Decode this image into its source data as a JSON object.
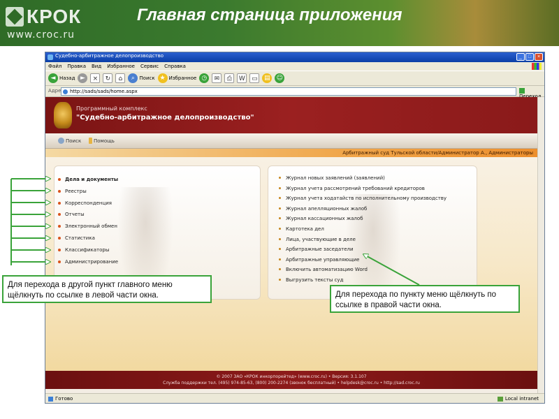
{
  "slide": {
    "logo_text": "КРОК",
    "logo_url": "www.croc.ru",
    "title": "Главная страница приложения"
  },
  "browser": {
    "title": "Судебно-арбитражное делопроизводство",
    "menu": [
      "Файл",
      "Правка",
      "Вид",
      "Избранное",
      "Сервис",
      "Справка"
    ],
    "toolbar": {
      "back_label": "Назад",
      "search_label": "Поиск",
      "favorites_label": "Избранное"
    },
    "address_label": "Адрес:",
    "address_value": "http://sads/sads/home.aspx",
    "go_label": "Переход",
    "status_left": "Готово",
    "status_right": "Local intranet"
  },
  "site": {
    "subtitle": "Программный комплекс",
    "name": "\"Судебно-арбитражное делопроизводство\"",
    "nav": {
      "search": "Поиск",
      "help": "Помощь"
    },
    "user_info": "Арбитражный суд Тульской области/Администратор А., Администраторы",
    "left_menu": [
      "Дела и документы",
      "Реестры",
      "Корреспонденция",
      "Отчеты",
      "Электронный обмен",
      "Статистика",
      "Классификаторы",
      "Администрирование"
    ],
    "right_menu": [
      "Журнал новых заявлений (заявлений)",
      "Журнал учета рассмотрений требований кредиторов",
      "Журнал учета ходатайств по исполнительному производству",
      "Журнал апелляционных жалоб",
      "Журнал кассационных жалоб",
      "Картотека дел",
      "Лица, участвующие в деле",
      "Арбитражные заседатели",
      "Арбитражные управляющие",
      "Включить автоматизацию Word",
      "Выгрузить тексты суд"
    ],
    "footer_line1": "© 2007 ЗАО «КРОК инкорпорейтед» (www.croc.ru) • Версия: 3.1.107",
    "footer_line2": "Служба поддержки тел. (495) 974-85-63, (800) 200-2274 (звонок бесплатный) • helpdesk@croc.ru • http://sad.croc.ru"
  },
  "callouts": {
    "left": "Для перехода в другой пункт главного меню щёлкнуть по ссылке в левой части окна.",
    "right": "Для перехода по пункту меню щёлкнуть по ссылке в правой части окна."
  },
  "colors": {
    "header_green": "#3b7a2e",
    "banner_red": "#8a1a1a",
    "user_bar_orange": "#ec8f2e",
    "callout_border": "#3aa33a"
  }
}
